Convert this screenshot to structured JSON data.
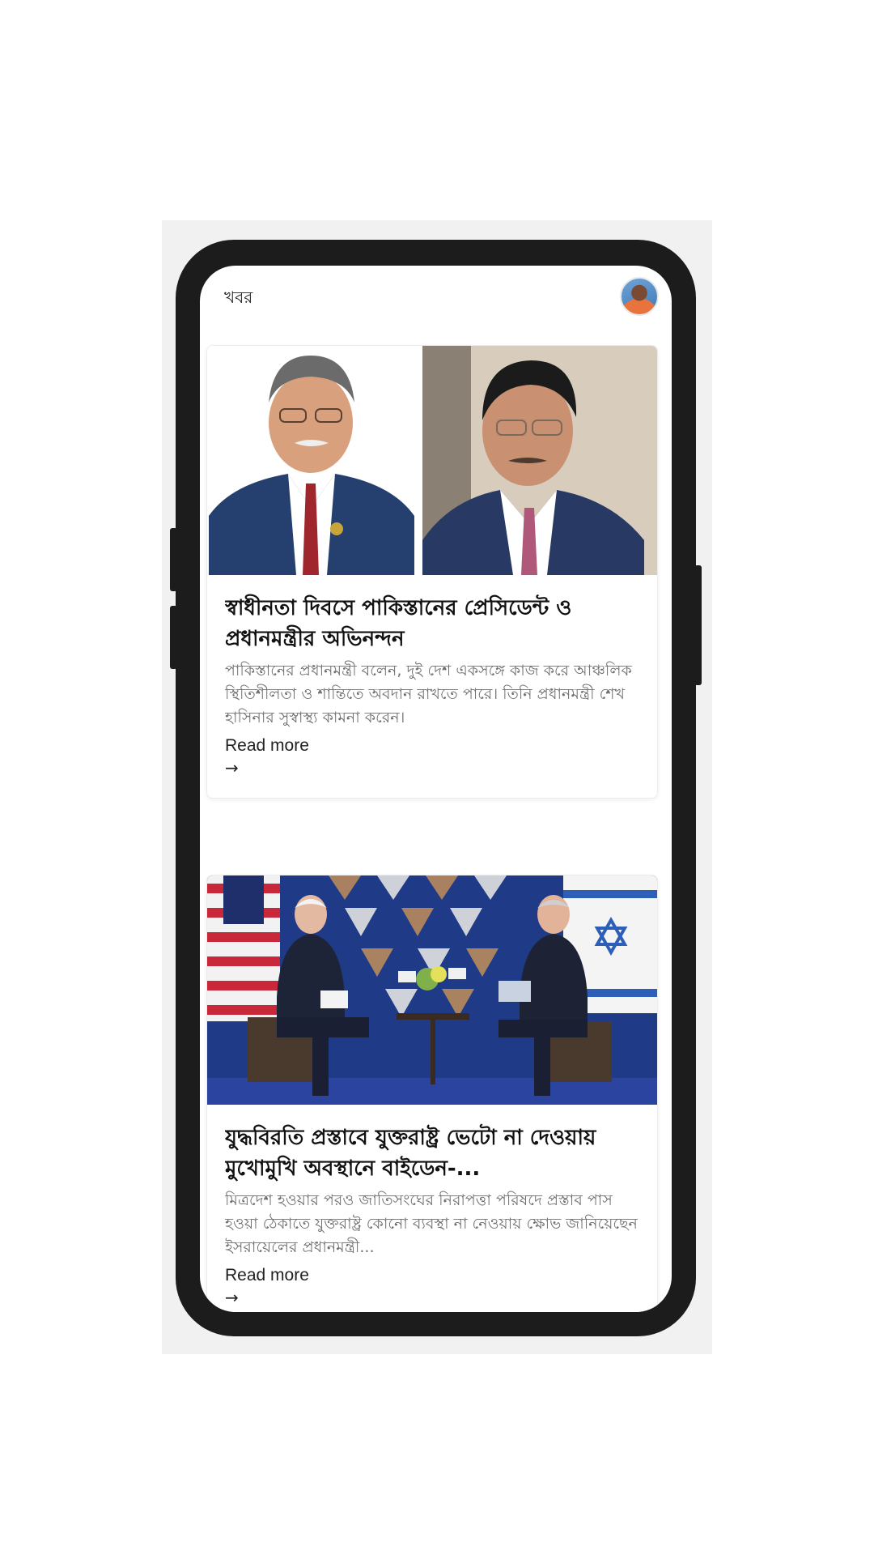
{
  "app": {
    "title": "খবর"
  },
  "articles": [
    {
      "title": "স্বাধীনতা দিবসে পাকিস্তানের প্রেসিডেন্ট ও প্রধানমন্ত্রীর অভিনন্দন",
      "summary": "পাকিস্তানের প্রধানমন্ত্রী বলেন, দুই দেশ একসঙ্গে কাজ করে আঞ্চলিক স্থিতিশীলতা ও শান্তিতে অবদান রাখতে পারে। তিনি প্রধানমন্ত্রী শেখ হাসিনার সুস্বাস্থ্য কামনা করেন।",
      "read_more": "Read more",
      "arrow": "→"
    },
    {
      "title": "যুদ্ধবিরতি প্রস্তাবে যুক্তরাষ্ট্র ভেটো না দেওয়ায় মুখোমুখি অবস্থানে বাইডেন-...",
      "summary": "মিত্রদেশ হওয়ার পরও জাতিসংঘের নিরাপত্তা পরিষদে প্রস্তাব পাস হওয়া ঠেকাতে যুক্তরাষ্ট্র কোনো ব্যবস্থা না নেওয়ায় ক্ষোভ জানিয়েছেন ইসরায়েলের প্রধানমন্ত্রী...",
      "read_more": "Read more",
      "arrow": "→"
    }
  ],
  "colors": {
    "phone_frame": "#1c1c1c",
    "text_primary": "#111111",
    "text_secondary": "#6f6f6f"
  }
}
